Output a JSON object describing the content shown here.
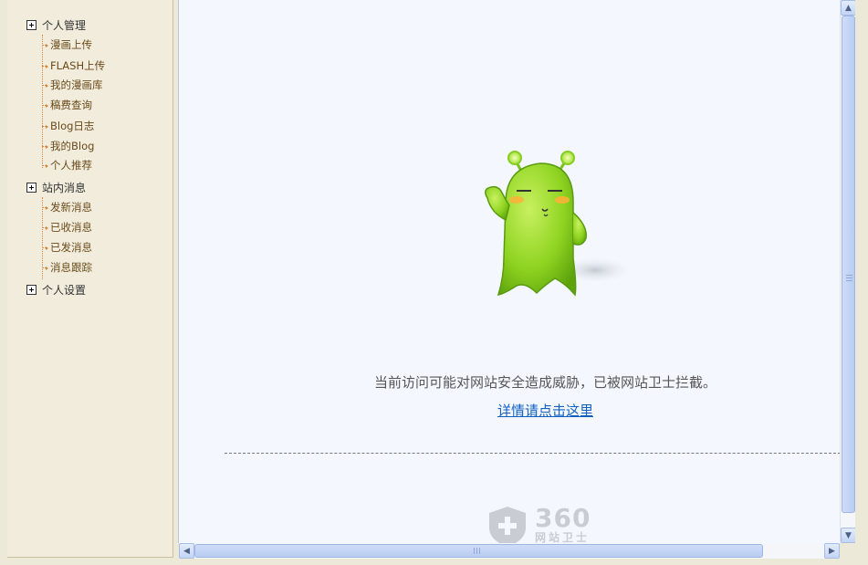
{
  "sidebar": {
    "groups": [
      {
        "label": "个人管理",
        "items": [
          "漫画上传",
          "FLASH上传",
          "我的漫画库",
          "稿费查询",
          "Blog日志",
          "我的Blog",
          "个人推荐"
        ]
      },
      {
        "label": "站内消息",
        "items": [
          "发新消息",
          "已收消息",
          "已发消息",
          "消息跟踪"
        ]
      },
      {
        "label": "个人设置",
        "items": []
      }
    ]
  },
  "main": {
    "warning_message": "当前访问可能对网站安全造成威胁，已被网站卫士拦截。",
    "detail_link": "详情请点击这里",
    "logo": {
      "number": "360",
      "subtitle": "网站卫士"
    }
  },
  "colors": {
    "sidebar_bg": "#f1ecdc",
    "main_bg": "#f4f8fe",
    "link": "#1060c0",
    "mascot_green": "#8fd421"
  }
}
